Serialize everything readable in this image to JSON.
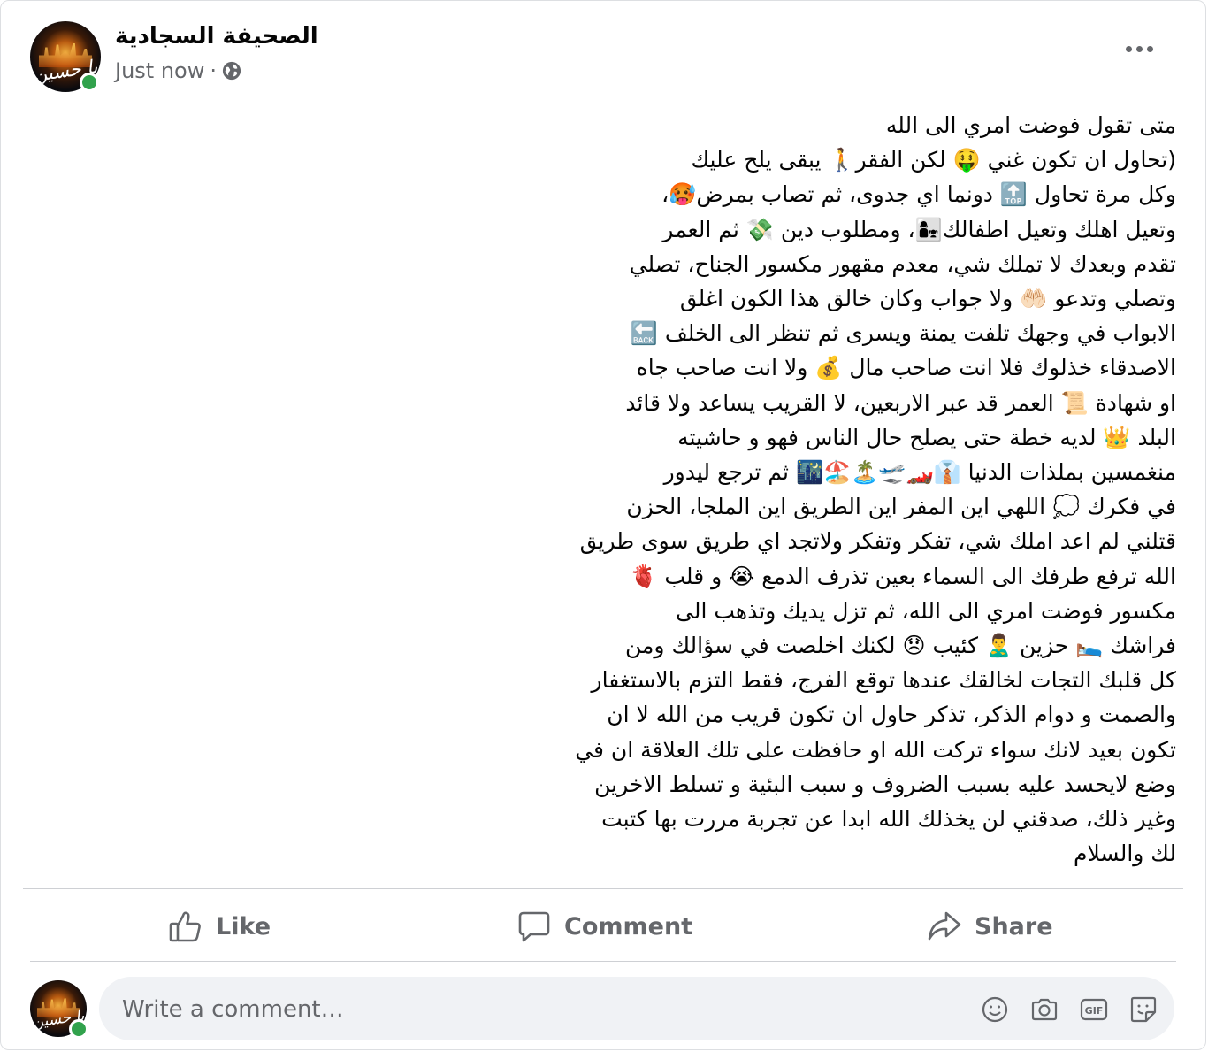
{
  "post": {
    "page_name": "الصحيفة السجادية",
    "time": "Just now",
    "dot": "·",
    "avatar_text": "يا حسين",
    "text": "متى تقول فوضت امري الى الله\n(تحاول ان تكون غني 🤑 لكن الفقر🚶 يبقى يلح عليك\nوكل مرة تحاول 🔝 دونما اي جدوى، ثم تصاب بمرض🥵،\nوتعيل اهلك وتعيل اطفالك👩‍👧، ومطلوب دين 💸 ثم العمر\nتقدم وبعدك لا تملك شي، معدم مقهور مكسور الجناح، تصلي\nوتصلي وتدعو 🤲🏻 ولا جواب وكان خالق هذا الكون اغلق\nالابواب في وجهك تلفت يمنة ويسرى ثم تنظر الى الخلف 🔙\nالاصدقاء خذلوك فلا انت صاحب مال 💰 ولا انت صاحب جاه\nاو شهادة 📜 العمر قد عبر الاربعين، لا القريب يساعد ولا قائد\nالبلد 👑 لديه خطة حتى يصلح حال الناس فهو و حاشيته\nمنغمسين بملذات الدنيا 👔🏎️🛫🏝️🏖️🌃 ثم ترجع ليدور\nفي فكرك 💭 اللهي اين المفر اين الطريق اين الملجا، الحزن\nقتلني لم اعد املك شي، تفكر وتفكر ولاتجد اي طريق سوى طريق\nالله ترفع طرفك الى السماء بعين تذرف الدمع 😭 و قلب 🫀\nمكسور فوضت امري الى الله، ثم تزل يديك وتذهب الى\nفراشك 🛌 حزين 🙎‍♂️ كئيب 😞 لكنك اخلصت في سؤالك ومن\nكل قلبك التجات لخالقك عندها توقع الفرج، فقط التزم بالاستغفار\nوالصمت و دوام الذكر، تذكر حاول ان تكون قريب من الله لا ان\nتكون بعيد لانك سواء تركت الله او حافظت على تلك العلاقة ان في\nوضع لايحسد عليه بسبب الضروف و سبب البئية و تسلط الاخرين\nوغير ذلك، صدقني لن يخذلك الله ابدا عن تجربة مررت بها كتبت\nلك والسلام"
  },
  "actions": {
    "like": "Like",
    "comment": "Comment",
    "share": "Share"
  },
  "comment": {
    "placeholder": "Write a comment…"
  },
  "icons": {
    "globe": "globe-icon",
    "more": "more-options-icon",
    "like": "thumbs-up-icon",
    "comment": "speech-bubble-icon",
    "share": "share-arrow-icon",
    "emoji": "smiley-icon",
    "camera": "camera-icon",
    "gif": "gif-icon",
    "sticker": "sticker-icon"
  },
  "colors": {
    "secondary_text": "#65676b",
    "online": "#31a24c",
    "input_bg": "#f0f2f5"
  }
}
